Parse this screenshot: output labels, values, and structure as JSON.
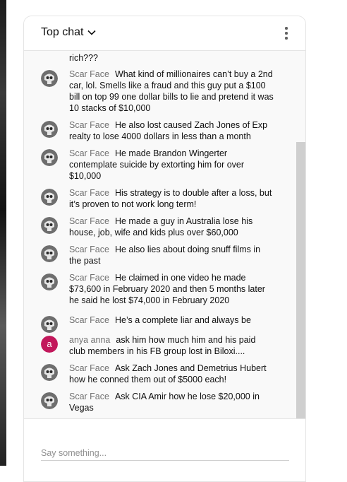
{
  "chat": {
    "title": "Top chat",
    "partial_text": "rich???",
    "input_placeholder": "Say something...",
    "messages": [
      {
        "author": "Scar Face",
        "avatar": "skull-avatar",
        "text": "What kind of millionaires can’t buy a 2nd car, lol. Smells like a fraud and this guy put a $100 bill on top 99 one dollar bills to lie and pretend it was 10 stacks of $10,000"
      },
      {
        "author": "Scar Face",
        "avatar": "skull-avatar",
        "text": "He also lost caused Zach Jones of Exp realty to lose 4000 dollars in less than a month"
      },
      {
        "author": "Scar Face",
        "avatar": "skull-avatar",
        "text": "He made Brandon Wingerter contemplate suicide by extorting him for over $10,000"
      },
      {
        "author": "Scar Face",
        "avatar": "skull-avatar",
        "text": "His strategy is to double after a loss, but it’s proven to not work long term!"
      },
      {
        "author": "Scar Face",
        "avatar": "skull-avatar",
        "text": "He made a guy in Australia lose his house, job, wife and kids plus over $60,000"
      },
      {
        "author": "Scar Face",
        "avatar": "skull-avatar",
        "text": "He also lies about doing snuff films in the past"
      },
      {
        "author": "Scar Face",
        "avatar": "skull-avatar",
        "text": "He claimed in one video he made $73,600 in February 2020 and then 5 months later he said he lost $74,000 in February 2020"
      },
      {
        "author": "Scar Face",
        "avatar": "skull-avatar",
        "text": "He’s a complete liar and always be"
      },
      {
        "author": "anya anna",
        "avatar": "letter-a",
        "avatar_letter": "a",
        "text": "ask him how much him and his paid club members in his FB group lost in Biloxi...."
      },
      {
        "author": "Scar Face",
        "avatar": "skull-avatar",
        "text": "Ask Zach Jones and Demetrius Hubert how he conned them out of $5000 each!"
      },
      {
        "author": "Scar Face",
        "avatar": "skull-avatar",
        "text": "Ask CIA Amir how he lose $20,000 in Vegas"
      }
    ]
  },
  "colors": {
    "author": "#717171",
    "panel_bg": "#f9f9f9",
    "anya_avatar": "#c2185b",
    "scroll_thumb": "#cfcfcf"
  }
}
